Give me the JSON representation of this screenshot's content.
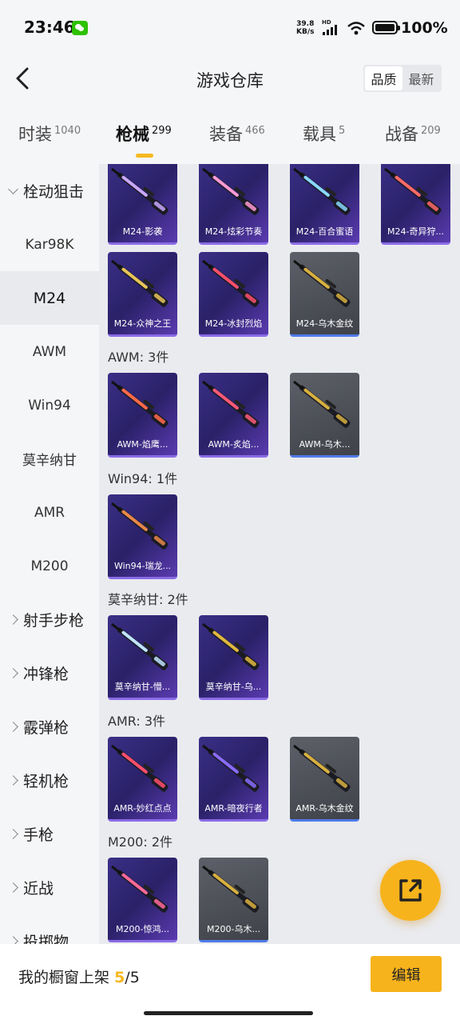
{
  "status_bar": {
    "time": "23:46",
    "net_speed_value": "39.8",
    "net_speed_unit": "KB/s",
    "hd_label": "HD",
    "battery": "100%"
  },
  "header": {
    "title": "游戏仓库",
    "sort_options": [
      "品质",
      "最新"
    ],
    "sort_active": "品质"
  },
  "tabs": [
    {
      "label": "时装",
      "count": "1040"
    },
    {
      "label": "枪械",
      "count": "299",
      "active": true
    },
    {
      "label": "装备",
      "count": "466"
    },
    {
      "label": "载具",
      "count": "5"
    },
    {
      "label": "战备",
      "count": "209"
    }
  ],
  "sidebar": {
    "items": [
      {
        "label": "栓动狙击",
        "type": "group",
        "expanded": true
      },
      {
        "label": "Kar98K",
        "type": "sub"
      },
      {
        "label": "M24",
        "type": "sub",
        "active": true
      },
      {
        "label": "AWM",
        "type": "sub"
      },
      {
        "label": "Win94",
        "type": "sub"
      },
      {
        "label": "莫辛纳甘",
        "type": "sub"
      },
      {
        "label": "AMR",
        "type": "sub"
      },
      {
        "label": "M200",
        "type": "sub"
      },
      {
        "label": "射手步枪",
        "type": "group"
      },
      {
        "label": "冲锋枪",
        "type": "group"
      },
      {
        "label": "霰弹枪",
        "type": "group"
      },
      {
        "label": "轻机枪",
        "type": "group"
      },
      {
        "label": "手枪",
        "type": "group"
      },
      {
        "label": "近战",
        "type": "group"
      },
      {
        "label": "投掷物",
        "type": "group"
      }
    ]
  },
  "sections": [
    {
      "title": "",
      "items": [
        {
          "name": "M24-影袭",
          "style": "purple",
          "accent": "#c9a7ff"
        },
        {
          "name": "M24-炫彩节奏",
          "style": "purple",
          "accent": "#ff9ad5"
        },
        {
          "name": "M24-百合蜜语",
          "style": "purple",
          "accent": "#8ad8ff"
        },
        {
          "name": "M24-奇异狩...",
          "style": "purple",
          "accent": "#ff6a6a"
        }
      ]
    },
    {
      "title": "",
      "items": [
        {
          "name": "M24-众神之王",
          "style": "purple",
          "accent": "#e8c45a"
        },
        {
          "name": "M24-冰封烈焰",
          "style": "purple",
          "accent": "#ff4f6d"
        },
        {
          "name": "M24-乌木金纹",
          "style": "gray",
          "accent": "#d8b040"
        }
      ]
    },
    {
      "title": "AWM: 3件",
      "items": [
        {
          "name": "AWM-焰鹰...",
          "style": "purple",
          "accent": "#ff6a4a"
        },
        {
          "name": "AWM-炙焰...",
          "style": "purple",
          "accent": "#ff5a7a"
        },
        {
          "name": "AWM-乌木...",
          "style": "gray",
          "accent": "#d8b040"
        }
      ]
    },
    {
      "title": "Win94: 1件",
      "items": [
        {
          "name": "Win94-瑞龙...",
          "style": "purple",
          "accent": "#e8884a"
        }
      ]
    },
    {
      "title": "莫辛纳甘: 2件",
      "items": [
        {
          "name": "莫辛纳甘-懵...",
          "style": "purple",
          "accent": "#bfe4ff"
        },
        {
          "name": "莫辛纳甘-乌...",
          "style": "purple",
          "accent": "#e0b840"
        }
      ]
    },
    {
      "title": "AMR: 3件",
      "items": [
        {
          "name": "AMR-妙红点点",
          "style": "purple",
          "accent": "#ff4f6d"
        },
        {
          "name": "AMR-暗夜行者",
          "style": "purple",
          "accent": "#8a6bff"
        },
        {
          "name": "AMR-乌木金纹",
          "style": "gray",
          "accent": "#d8b040"
        }
      ]
    },
    {
      "title": "M200: 2件",
      "items": [
        {
          "name": "M200-惊鸿...",
          "style": "purple",
          "accent": "#ff6a9a"
        },
        {
          "name": "M200-乌木...",
          "style": "gray",
          "accent": "#d8b040"
        }
      ]
    }
  ],
  "bottom_bar": {
    "showcase_label": "我的橱窗上架",
    "showcase_used": "5",
    "showcase_total": "/5",
    "edit_label": "编辑"
  },
  "colors": {
    "accent": "#f7b31c",
    "card_purple": "#2a2168",
    "card_gray": "#4a4d55"
  }
}
